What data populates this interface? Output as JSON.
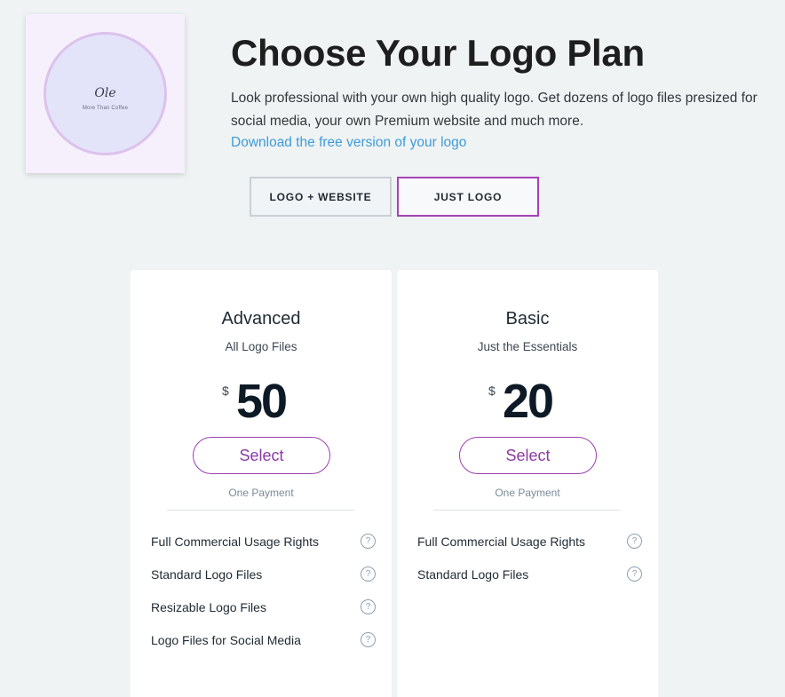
{
  "logo_preview": {
    "name": "Ole",
    "tagline": "More Than Coffee"
  },
  "header": {
    "title": "Choose Your Logo Plan",
    "description": "Look professional with your own high quality logo. Get dozens of logo files presized for social media, your own Premium website and much more.",
    "download_link": "Download the free version of your logo"
  },
  "toggle": {
    "options": [
      "LOGO + WEBSITE",
      "JUST LOGO"
    ],
    "selected": "JUST LOGO"
  },
  "plans": [
    {
      "name": "Advanced",
      "subtitle": "All Logo Files",
      "currency": "$",
      "price": "50",
      "select_label": "Select",
      "payment_note": "One Payment",
      "features": [
        "Full Commercial Usage Rights",
        "Standard Logo Files",
        "Resizable Logo Files",
        "Logo Files for Social Media"
      ]
    },
    {
      "name": "Basic",
      "subtitle": "Just the Essentials",
      "currency": "$",
      "price": "20",
      "select_label": "Select",
      "payment_note": "One Payment",
      "features": [
        "Full Commercial Usage Rights",
        "Standard Logo Files"
      ]
    }
  ],
  "icons": {
    "help": "question-mark-circle-icon"
  },
  "colors": {
    "accent": "#9a3fb0",
    "link": "#3f9bd8",
    "background": "#eff3f4"
  }
}
